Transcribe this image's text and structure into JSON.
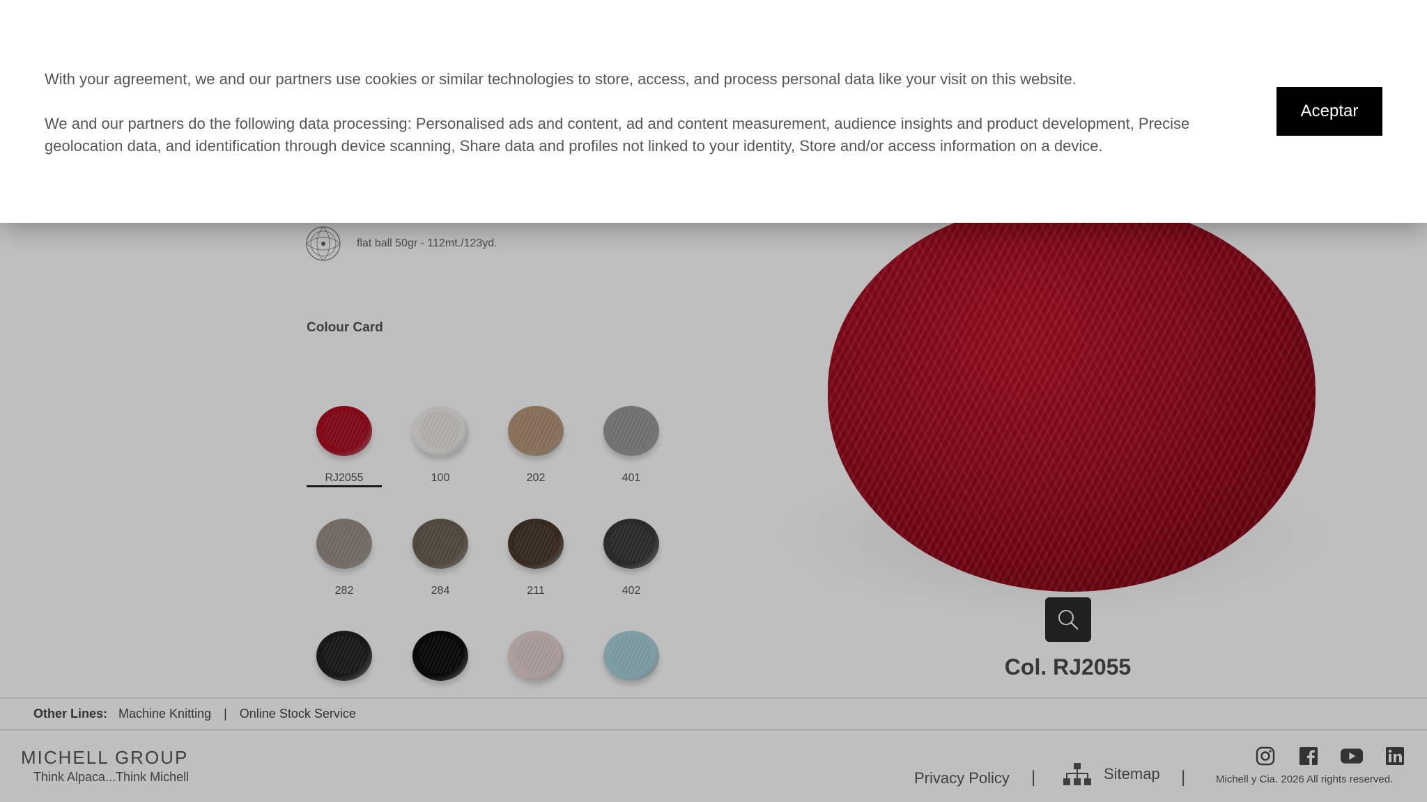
{
  "product": {
    "yarn_type_label": "flat ball 50gr - 112mt./123yd.",
    "colour_card_title": "Colour Card",
    "selected_colour_name": "Col. RJ2055"
  },
  "swatches": [
    {
      "code": "RJ2055",
      "color": "#b00d22",
      "selected": true
    },
    {
      "code": "100",
      "color": "#f2f1ee",
      "selected": false
    },
    {
      "code": "202",
      "color": "#b8977a",
      "selected": false
    },
    {
      "code": "401",
      "color": "#9a9a9a",
      "selected": false
    },
    {
      "code": "282",
      "color": "#9b9086",
      "selected": false
    },
    {
      "code": "284",
      "color": "#6e6253",
      "selected": false
    },
    {
      "code": "211",
      "color": "#4a3a2c",
      "selected": false
    },
    {
      "code": "402",
      "color": "#3a3a3a",
      "selected": false
    },
    {
      "code": "",
      "color": "#222222",
      "selected": false
    },
    {
      "code": "",
      "color": "#0c0c0c",
      "selected": false
    },
    {
      "code": "",
      "color": "#e6d4cf",
      "selected": false
    },
    {
      "code": "",
      "color": "#a9d3db",
      "selected": false
    }
  ],
  "other_lines": {
    "label": "Other Lines:",
    "links": [
      "Machine Knitting",
      "Online Stock Service"
    ],
    "separator": "|"
  },
  "footer": {
    "logo": "MICHELL GROUP",
    "tagline": "Think Alpaca...Think Michell",
    "privacy": "Privacy Policy",
    "sitemap": "Sitemap",
    "separator": "|",
    "copyright": "Michell y Cia. 2026 All rights reserved.",
    "social": [
      "instagram-icon",
      "facebook-icon",
      "youtube-icon",
      "linkedin-icon"
    ]
  },
  "cookie": {
    "paragraph1": "With your agreement, we and our partners use cookies or similar technologies to store, access, and process personal data like your visit on this website.",
    "paragraph2": "We and our partners do the following data processing: Personalised ads and content, ad and content measurement, audience insights and product development, Precise geolocation data, and identification through device scanning, Share data and profiles not linked to your identity, Store and/or access information on a device.",
    "accept_label": "Aceptar"
  },
  "colors": {
    "accent_red": "#b00d22",
    "button_black": "#000000"
  }
}
